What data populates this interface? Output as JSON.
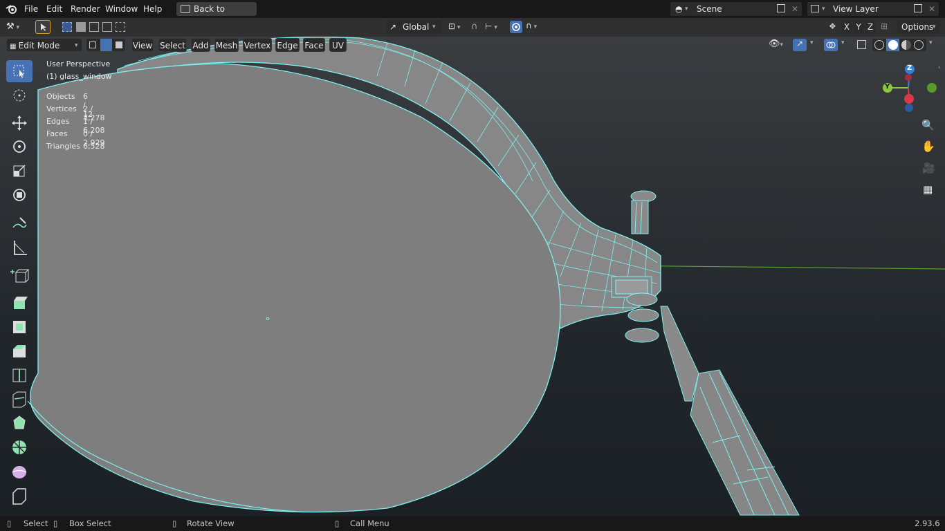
{
  "menubar": {
    "items": [
      "File",
      "Edit",
      "Render",
      "Window",
      "Help"
    ],
    "back_button": "Back to Previous",
    "scene_name": "Scene",
    "view_layer": "View Layer"
  },
  "toolheader": {
    "orientation": "Global",
    "axes": [
      "X",
      "Y",
      "Z"
    ],
    "options_label": "Options"
  },
  "viewport_header": {
    "mode": "Edit Mode",
    "menus": [
      "View",
      "Select",
      "Add",
      "Mesh",
      "Vertex",
      "Edge",
      "Face",
      "UV"
    ]
  },
  "overlay": {
    "perspective": "User Perspective",
    "object": "(1) glass_window",
    "stats": [
      {
        "label": "Objects",
        "value": "6 / 12"
      },
      {
        "label": "Vertices",
        "value": "2 / 3,278"
      },
      {
        "label": "Edges",
        "value": "1 / 6,208"
      },
      {
        "label": "Faces",
        "value": "0 / 2,929"
      },
      {
        "label": "Triangles",
        "value": "6,528"
      }
    ]
  },
  "gizmo": {
    "z": "Z",
    "y": "Y"
  },
  "toolbar": {
    "tools": [
      "select-box-icon",
      "cursor-icon",
      "move-icon",
      "rotate-icon",
      "scale-icon",
      "transform-icon",
      "annotate-icon",
      "measure-icon",
      "add-cube-icon",
      "extrude-icon",
      "inset-icon",
      "bevel-icon",
      "loop-cut-icon",
      "knife-icon",
      "poly-build-icon",
      "spin-icon",
      "smooth-icon",
      "shear-icon"
    ]
  },
  "statusbar": {
    "select": "Select",
    "box_select": "Box Select",
    "rotate_view": "Rotate View",
    "call_menu": "Call Menu",
    "version": "2.93.6"
  },
  "colors": {
    "accent": "#4772b3",
    "wire": "#7ff0f0",
    "face": "#7e7e7e"
  }
}
